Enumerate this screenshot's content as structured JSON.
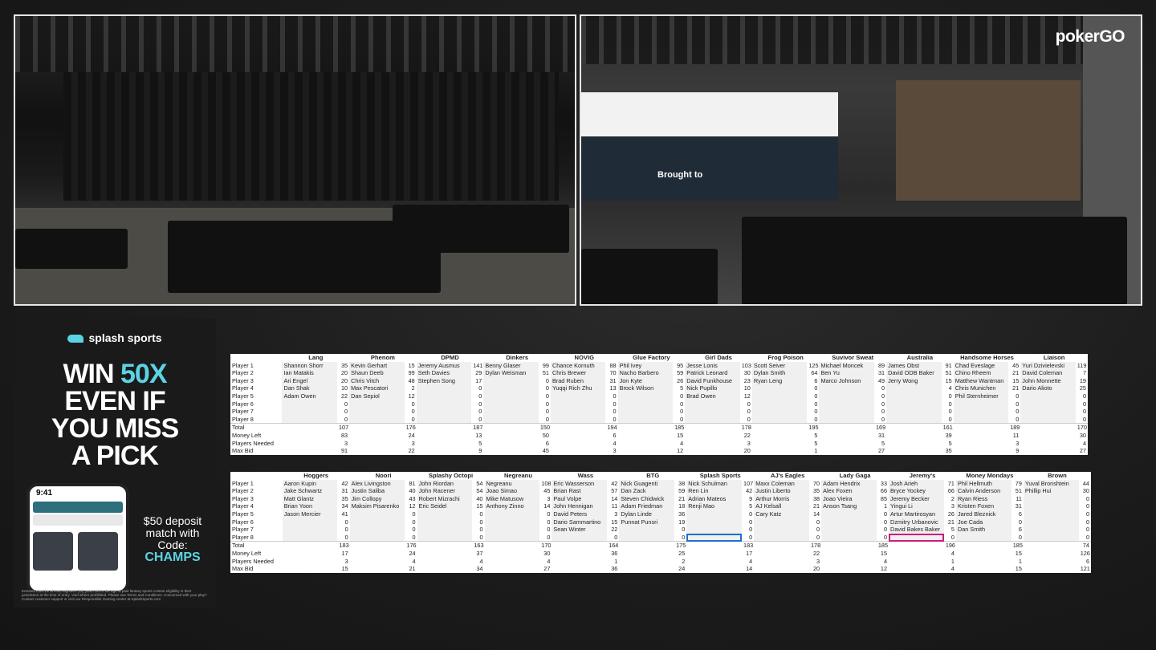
{
  "stream": {
    "brand_logo": "pokerGO",
    "sponsor_banner": "Brought to"
  },
  "ad": {
    "brand": "splash sports",
    "headline_1": "WIN",
    "headline_accent": "50X",
    "headline_2": "EVEN IF",
    "headline_3": "YOU MISS",
    "headline_4": "A PICK",
    "phone_time": "9:41",
    "deposit_text": "$50 deposit match with Code:",
    "code": "CHAMPS",
    "fine_print": "Entrants must be at least eighteen (18) years old or the age of paid fantasy sports contest eligibility in their jurisdiction at the time of entry. Void where prohibited. Please see Terms and Conditions. Concerned with your play? Contact customer support or visit our Responsible Gaming center at SplashSports.com"
  },
  "row_labels": [
    "Player 1",
    "Player 2",
    "Player 3",
    "Player 4",
    "Player 5",
    "Player 6",
    "Player 7",
    "Player 8",
    "Total",
    "Money Left",
    "Players Needed",
    "Max Bid"
  ],
  "table1": {
    "teams": [
      {
        "name": "Lang",
        "players": [
          [
            "Shannon Shorr",
            "35"
          ],
          [
            "Ian Matakis",
            "20"
          ],
          [
            "Ari Engel",
            "20"
          ],
          [
            "Dan Shak",
            "10"
          ],
          [
            "Adam Owen",
            "22"
          ],
          [
            "",
            "0"
          ],
          [
            "",
            "0"
          ],
          [
            "",
            "0"
          ]
        ],
        "total": "107",
        "money_left": "83",
        "needed": "3",
        "max_bid": "91"
      },
      {
        "name": "Phenom",
        "players": [
          [
            "Kevin Gerhart",
            "15"
          ],
          [
            "Shaun Deeb",
            "99"
          ],
          [
            "Chris Vitch",
            "48"
          ],
          [
            "Max Pescatori",
            "2"
          ],
          [
            "Dan Sepiol",
            "12"
          ],
          [
            "",
            "0"
          ],
          [
            "",
            "0"
          ],
          [
            "",
            "0"
          ]
        ],
        "total": "176",
        "money_left": "24",
        "needed": "3",
        "max_bid": "22"
      },
      {
        "name": "DPMD",
        "players": [
          [
            "Jeremy Ausmus",
            "141"
          ],
          [
            "Seth Davies",
            "29"
          ],
          [
            "Stephen Song",
            "17"
          ],
          [
            "",
            "0"
          ],
          [
            "",
            "0"
          ],
          [
            "",
            "0"
          ],
          [
            "",
            "0"
          ],
          [
            "",
            "0"
          ]
        ],
        "total": "187",
        "money_left": "13",
        "needed": "5",
        "max_bid": "9"
      },
      {
        "name": "Dinkers",
        "players": [
          [
            "Benny Glaser",
            "99"
          ],
          [
            "Dylan Weisman",
            "51"
          ],
          [
            "",
            "0"
          ],
          [
            "",
            "0"
          ],
          [
            "",
            "0"
          ],
          [
            "",
            "0"
          ],
          [
            "",
            "0"
          ],
          [
            "",
            "0"
          ]
        ],
        "total": "150",
        "money_left": "50",
        "needed": "6",
        "max_bid": "45"
      },
      {
        "name": "NOVIG",
        "players": [
          [
            "Chance Kornuth",
            "88"
          ],
          [
            "Chris Brewer",
            "70"
          ],
          [
            "Brad Ruben",
            "31"
          ],
          [
            "Yuqqi Rich Zhu",
            "13"
          ],
          [
            "",
            "0"
          ],
          [
            "",
            "0"
          ],
          [
            "",
            "0"
          ],
          [
            "",
            "0"
          ]
        ],
        "total": "194",
        "money_left": "6",
        "needed": "4",
        "max_bid": "3"
      },
      {
        "name": "Glue Factory",
        "players": [
          [
            "Phil Ivey",
            "95"
          ],
          [
            "Nacho Barbero",
            "59"
          ],
          [
            "Jon Kyte",
            "26"
          ],
          [
            "Brock Wilson",
            "5"
          ],
          [
            "",
            "0"
          ],
          [
            "",
            "0"
          ],
          [
            "",
            "0"
          ],
          [
            "",
            "0"
          ]
        ],
        "total": "185",
        "money_left": "15",
        "needed": "4",
        "max_bid": "12"
      },
      {
        "name": "Girl Dads",
        "players": [
          [
            "Jesse Lonis",
            "103"
          ],
          [
            "Patrick Leonard",
            "30"
          ],
          [
            "David Funkhouse",
            "23"
          ],
          [
            "Nick Pupillo",
            "10"
          ],
          [
            "Brad Owen",
            "12"
          ],
          [
            "",
            "0"
          ],
          [
            "",
            "0"
          ],
          [
            "",
            "0"
          ]
        ],
        "total": "178",
        "money_left": "22",
        "needed": "3",
        "max_bid": "20"
      },
      {
        "name": "Frog Poison",
        "players": [
          [
            "Scott Seiver",
            "125"
          ],
          [
            "Dylan Smith",
            "64"
          ],
          [
            "Ryan Leng",
            "6"
          ],
          [
            "",
            "0"
          ],
          [
            "",
            "0"
          ],
          [
            "",
            "0"
          ],
          [
            "",
            "0"
          ],
          [
            "",
            "0"
          ]
        ],
        "total": "195",
        "money_left": "5",
        "needed": "5",
        "max_bid": "1"
      },
      {
        "name": "Suvivor Sweat",
        "players": [
          [
            "Michael Moncek",
            "89"
          ],
          [
            "Ben Yu",
            "31"
          ],
          [
            "Marco Johnson",
            "49"
          ],
          [
            "",
            "0"
          ],
          [
            "",
            "0"
          ],
          [
            "",
            "0"
          ],
          [
            "",
            "0"
          ],
          [
            "",
            "0"
          ]
        ],
        "total": "169",
        "money_left": "31",
        "needed": "5",
        "max_bid": "27"
      },
      {
        "name": "Australia",
        "players": [
          [
            "James Obst",
            "91"
          ],
          [
            "David ODB Baker",
            "51"
          ],
          [
            "Jerry Wong",
            "15"
          ],
          [
            "",
            "4"
          ],
          [
            "",
            "0"
          ],
          [
            "",
            "0"
          ],
          [
            "",
            "0"
          ],
          [
            "",
            "0"
          ]
        ],
        "total": "161",
        "money_left": "39",
        "needed": "5",
        "max_bid": "35"
      },
      {
        "name": "Handsome Horses",
        "players": [
          [
            "Chad Eveslage",
            "45"
          ],
          [
            "Chino Rheem",
            "21"
          ],
          [
            "Matthew Wantman",
            "15"
          ],
          [
            "Chris Munichen",
            "21"
          ],
          [
            "Phil Sternheimer",
            "0"
          ],
          [
            "",
            "0"
          ],
          [
            "",
            "0"
          ],
          [
            "",
            "0"
          ]
        ],
        "total": "189",
        "money_left": "11",
        "needed": "3",
        "max_bid": "9"
      },
      {
        "name": "Liaison",
        "players": [
          [
            "Yuri Dzivielevski",
            "119"
          ],
          [
            "David Coleman",
            "7"
          ],
          [
            "John Monnette",
            "19"
          ],
          [
            "Dario Alioto",
            "25"
          ],
          [
            "",
            "0"
          ],
          [
            "",
            "0"
          ],
          [
            "",
            "0"
          ],
          [
            "",
            "0"
          ]
        ],
        "total": "170",
        "money_left": "30",
        "needed": "4",
        "max_bid": "27"
      }
    ]
  },
  "table2": {
    "teams": [
      {
        "name": "Hoggers",
        "players": [
          [
            "Aaron Kupin",
            "42"
          ],
          [
            "Jake Schwartz",
            "31"
          ],
          [
            "Matt Glantz",
            "35"
          ],
          [
            "Brian Yoon",
            "34"
          ],
          [
            "Jason Mercier",
            "41"
          ],
          [
            "",
            "0"
          ],
          [
            "",
            "0"
          ],
          [
            "",
            "0"
          ]
        ],
        "total": "183",
        "money_left": "17",
        "needed": "3",
        "max_bid": "15"
      },
      {
        "name": "Noori",
        "players": [
          [
            "Alex Livingston",
            "81"
          ],
          [
            "Justin Saliba",
            "40"
          ],
          [
            "Jim Collopy",
            "43"
          ],
          [
            "Maksim Pisarenko",
            "12"
          ],
          [
            "",
            "0"
          ],
          [
            "",
            "0"
          ],
          [
            "",
            "0"
          ],
          [
            "",
            "0"
          ]
        ],
        "total": "176",
        "money_left": "24",
        "needed": "4",
        "max_bid": "21"
      },
      {
        "name": "Splashy Octopi",
        "players": [
          [
            "John Riordan",
            "54"
          ],
          [
            "John Racener",
            "54"
          ],
          [
            "Robert Mizrachi",
            "40"
          ],
          [
            "Eric Seidel",
            "15"
          ],
          [
            "",
            "0"
          ],
          [
            "",
            "0"
          ],
          [
            "",
            "0"
          ],
          [
            "",
            "0"
          ]
        ],
        "total": "163",
        "money_left": "37",
        "needed": "4",
        "max_bid": "34"
      },
      {
        "name": "Negreanu",
        "players": [
          [
            "Negreanu",
            "108"
          ],
          [
            "Joao Simao",
            "45"
          ],
          [
            "Mike Matusow",
            "3"
          ],
          [
            "Anthony Zinno",
            "14"
          ],
          [
            "",
            "0"
          ],
          [
            "",
            "0"
          ],
          [
            "",
            "0"
          ],
          [
            "",
            "0"
          ]
        ],
        "total": "170",
        "money_left": "30",
        "needed": "4",
        "max_bid": "27"
      },
      {
        "name": "Wass",
        "players": [
          [
            "Eric Wasserson",
            "42"
          ],
          [
            "Brian Rast",
            "57"
          ],
          [
            "Paul Volpe",
            "14"
          ],
          [
            "John Hennigan",
            "11"
          ],
          [
            "David Peters",
            "3"
          ],
          [
            "Dario Sammartino",
            "15"
          ],
          [
            "Sean Winter",
            "22"
          ],
          [
            "",
            "0"
          ]
        ],
        "total": "164",
        "money_left": "36",
        "needed": "1",
        "max_bid": "36"
      },
      {
        "name": "BTG",
        "players": [
          [
            "Nick Guagenti",
            "38"
          ],
          [
            "Dan Zack",
            "59"
          ],
          [
            "Steven Chidwick",
            "21"
          ],
          [
            "Adam Friedman",
            "18"
          ],
          [
            "Dylan Linde",
            "36"
          ],
          [
            "Punnat Punsri",
            "19"
          ],
          [
            "",
            "0"
          ],
          [
            "",
            "0"
          ]
        ],
        "total": "175",
        "money_left": "25",
        "needed": "2",
        "max_bid": "24"
      },
      {
        "name": "Splash Sports",
        "players": [
          [
            "Nick Schulman",
            "107"
          ],
          [
            "Ren Lin",
            "42"
          ],
          [
            "Adrian Mateos",
            "9"
          ],
          [
            "Renji Mao",
            "5"
          ],
          [
            "",
            "0"
          ],
          [
            "",
            "0"
          ],
          [
            "",
            "0"
          ],
          [
            "",
            "0"
          ]
        ],
        "total": "183",
        "money_left": "17",
        "needed": "4",
        "max_bid": "14"
      },
      {
        "name": "AJ's Eagles",
        "players": [
          [
            "Maxx Coleman",
            "70"
          ],
          [
            "Justin Liberto",
            "35"
          ],
          [
            "Arthur Morris",
            "38"
          ],
          [
            "AJ Kelsall",
            "21"
          ],
          [
            "Cary Katz",
            "14"
          ],
          [
            "",
            "0"
          ],
          [
            "",
            "0"
          ],
          [
            "",
            "0"
          ]
        ],
        "total": "178",
        "money_left": "22",
        "needed": "3",
        "max_bid": "20"
      },
      {
        "name": "Lady Gaga",
        "players": [
          [
            "Adam Hendrix",
            "33"
          ],
          [
            "Alex Foxen",
            "66"
          ],
          [
            "Joao Vieira",
            "85"
          ],
          [
            "Anson Tsang",
            "1"
          ],
          [
            "",
            "0"
          ],
          [
            "",
            "0"
          ],
          [
            "",
            "0"
          ],
          [
            "",
            "0"
          ]
        ],
        "total": "185",
        "money_left": "15",
        "needed": "4",
        "max_bid": "12"
      },
      {
        "name": "Jeremy's",
        "players": [
          [
            "Josh Arieh",
            "71"
          ],
          [
            "Bryce Yockey",
            "66"
          ],
          [
            "Jeremy Becker",
            "2"
          ],
          [
            "Yingui Li",
            "3"
          ],
          [
            "Artur Martirosyan",
            "26"
          ],
          [
            "Dzmitry Urbanovic",
            "21"
          ],
          [
            "David Bakes Baker",
            "5"
          ],
          [
            "",
            "0"
          ]
        ],
        "total": "196",
        "money_left": "4",
        "needed": "1",
        "max_bid": "4"
      },
      {
        "name": "Money Mondays",
        "players": [
          [
            "Phil Hellmuth",
            "79"
          ],
          [
            "Calvin Anderson",
            "51"
          ],
          [
            "Ryan Riess",
            "11"
          ],
          [
            "Kristen Foxen",
            "31"
          ],
          [
            "Jared Bleznick",
            "6"
          ],
          [
            "Joe Cada",
            "0"
          ],
          [
            "Dan Smith",
            "6"
          ],
          [
            "",
            "0"
          ]
        ],
        "total": "185",
        "money_left": "15",
        "needed": "1",
        "max_bid": "15"
      },
      {
        "name": "Brown",
        "players": [
          [
            "Yuval Bronshtein",
            "44"
          ],
          [
            "Phillip Hui",
            "30"
          ],
          [
            "",
            "0"
          ],
          [
            "",
            "0"
          ],
          [
            "",
            "0"
          ],
          [
            "",
            "0"
          ],
          [
            "",
            "0"
          ],
          [
            "",
            "0"
          ]
        ],
        "total": "74",
        "money_left": "126",
        "needed": "6",
        "max_bid": "121"
      }
    ]
  }
}
